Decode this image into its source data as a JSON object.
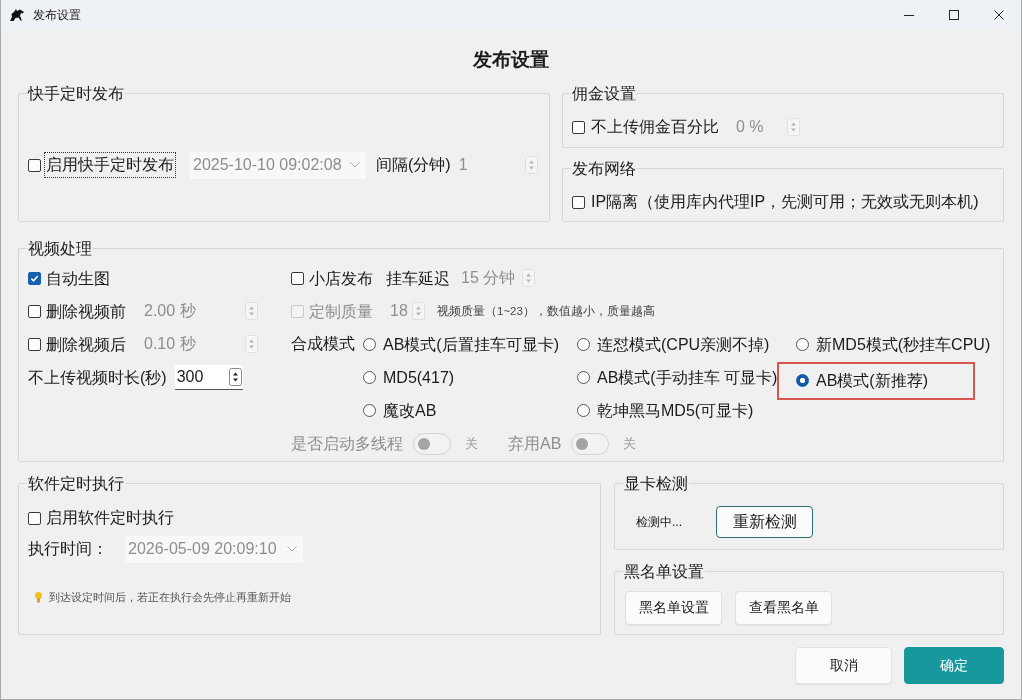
{
  "window": {
    "title": "发布设置"
  },
  "heading": "发布设置",
  "kuaishou_schedule": {
    "title": "快手定时发布",
    "enable": {
      "label": "启用快手定时发布",
      "checked": false,
      "focused": true
    },
    "publish_time": {
      "value": "2025-10-10 09:02:08",
      "disabled": true
    },
    "interval": {
      "label": "间隔(分钟)",
      "value": "1",
      "disabled": true
    }
  },
  "commission": {
    "title": "佣金设置",
    "skip_percent": {
      "label": "不上传佣金百分比",
      "checked": false
    },
    "percent": {
      "value": "0 %",
      "disabled": true
    }
  },
  "network": {
    "title": "发布网络",
    "ip_isolation": {
      "label": "IP隔离（使用库内代理IP，先测可用；无效或无则本机)",
      "checked": false
    }
  },
  "video": {
    "title": "视频处理",
    "left_rows": [
      {
        "kind": "checkbox",
        "label": "自动生图",
        "checked": true
      },
      {
        "kind": "checkbox_spin",
        "label": "删除视频前",
        "checked": false,
        "value": "2.00 秒",
        "disabled": true
      },
      {
        "kind": "checkbox_spin",
        "label": "删除视频后",
        "checked": false,
        "value": "0.10 秒",
        "disabled": true
      },
      {
        "kind": "label_spin",
        "label": "不上传视频时长(秒)",
        "value": "300",
        "disabled": false
      }
    ],
    "shop_publish": {
      "label": "小店发布",
      "checked": false
    },
    "cart_delay": {
      "label": "挂车延迟",
      "value": "15 分钟",
      "disabled": true
    },
    "custom_quality": {
      "label": "定制质量",
      "checked": false,
      "disabled": true,
      "value": "18",
      "note": "视频质量（1~23），数值越小，质量越高"
    },
    "compose_mode": {
      "label": "合成模式",
      "options": [
        {
          "label": "AB模式(后置挂车可显卡)",
          "selected": false,
          "highlighted": false
        },
        {
          "label": "连怼模式(CPU亲测不掉)",
          "selected": false,
          "highlighted": false
        },
        {
          "label": "新MD5模式(秒挂车CPU)",
          "selected": false,
          "highlighted": false
        },
        {
          "label": "MD5(417)",
          "selected": false,
          "highlighted": false
        },
        {
          "label": "AB模式(手动挂车 可显卡)",
          "selected": false,
          "highlighted": false
        },
        {
          "label": "AB模式(新推荐)",
          "selected": true,
          "highlighted": true
        },
        {
          "label": "魔改AB",
          "selected": false,
          "highlighted": false
        },
        {
          "label": "乾坤黑马MD5(可显卡)",
          "selected": false,
          "highlighted": false
        }
      ]
    },
    "switches": [
      {
        "label": "是否启动多线程",
        "on": false,
        "state_text": "关",
        "disabled": true
      },
      {
        "label": "弃用AB",
        "on": false,
        "state_text": "关",
        "disabled": true
      }
    ]
  },
  "software_schedule": {
    "title": "软件定时执行",
    "enable": {
      "label": "启用软件定时执行",
      "checked": false
    },
    "run_time": {
      "label": "执行时间：",
      "value": "2026-05-09 20:09:10",
      "disabled": true
    },
    "hint": "到达设定时间后，若正在执行会先停止再重新开始"
  },
  "gpu_check": {
    "title": "显卡检测",
    "status": "检测中...",
    "button": {
      "label": "重新检测",
      "focused": true
    }
  },
  "blacklist": {
    "title": "黑名单设置",
    "buttons": [
      "黑名单设置",
      "查看黑名单"
    ]
  },
  "footer": {
    "buttons": [
      {
        "label": "取消",
        "kind": "secondary"
      },
      {
        "label": "确定",
        "kind": "primary"
      }
    ]
  }
}
